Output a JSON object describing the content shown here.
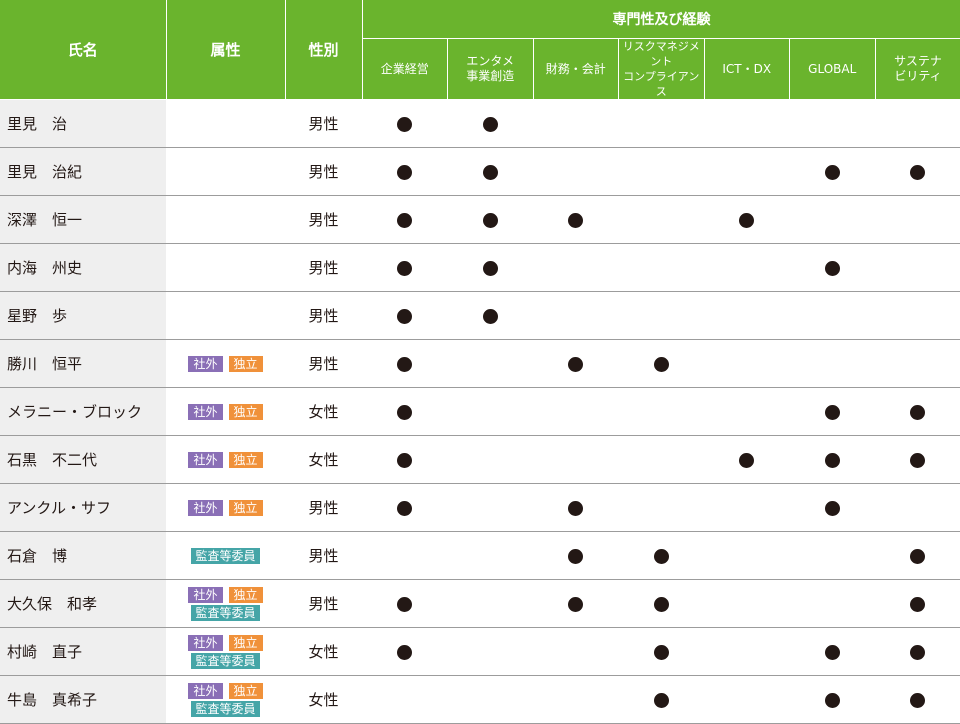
{
  "header": {
    "name": "氏名",
    "attribute": "属性",
    "gender": "性別",
    "expertise_group": "専門性及び経験",
    "skills": [
      {
        "line1": "企業経営",
        "line2": ""
      },
      {
        "line1": "エンタメ",
        "line2": "事業創造"
      },
      {
        "line1": "財務・会計",
        "line2": ""
      },
      {
        "line1": "リスクマネジメント",
        "line2": "コンプライアンス"
      },
      {
        "line1": "ICT・DX",
        "line2": ""
      },
      {
        "line1": "GLOBAL",
        "line2": ""
      },
      {
        "line1": "サステナ",
        "line2": "ビリティ"
      }
    ]
  },
  "badges": {
    "outside": "社外",
    "independent": "独立",
    "audit": "監査等委員"
  },
  "colors": {
    "header_green": "#6ab42d",
    "outside_purple": "#8a6fb6",
    "independent_orange": "#f0913a",
    "audit_teal": "#45a5a7",
    "name_cell_gray": "#efefef"
  },
  "rows": [
    {
      "name": "里見　治",
      "outside": false,
      "independent": false,
      "audit": false,
      "gender": "男性",
      "skills": [
        true,
        true,
        false,
        false,
        false,
        false,
        false
      ]
    },
    {
      "name": "里見　治紀",
      "outside": false,
      "independent": false,
      "audit": false,
      "gender": "男性",
      "skills": [
        true,
        true,
        false,
        false,
        false,
        true,
        true
      ]
    },
    {
      "name": "深澤　恒一",
      "outside": false,
      "independent": false,
      "audit": false,
      "gender": "男性",
      "skills": [
        true,
        true,
        true,
        false,
        true,
        false,
        false
      ]
    },
    {
      "name": "内海　州史",
      "outside": false,
      "independent": false,
      "audit": false,
      "gender": "男性",
      "skills": [
        true,
        true,
        false,
        false,
        false,
        true,
        false
      ]
    },
    {
      "name": "星野　歩",
      "outside": false,
      "independent": false,
      "audit": false,
      "gender": "男性",
      "skills": [
        true,
        true,
        false,
        false,
        false,
        false,
        false
      ]
    },
    {
      "name": "勝川　恒平",
      "outside": true,
      "independent": true,
      "audit": false,
      "gender": "男性",
      "skills": [
        true,
        false,
        true,
        true,
        false,
        false,
        false
      ]
    },
    {
      "name": "メラニー・ブロック",
      "outside": true,
      "independent": true,
      "audit": false,
      "gender": "女性",
      "skills": [
        true,
        false,
        false,
        false,
        false,
        true,
        true
      ]
    },
    {
      "name": "石黒　不二代",
      "outside": true,
      "independent": true,
      "audit": false,
      "gender": "女性",
      "skills": [
        true,
        false,
        false,
        false,
        true,
        true,
        true
      ]
    },
    {
      "name": "アンクル・サフ",
      "outside": true,
      "independent": true,
      "audit": false,
      "gender": "男性",
      "skills": [
        true,
        false,
        true,
        false,
        false,
        true,
        false
      ]
    },
    {
      "name": "石倉　博",
      "outside": false,
      "independent": false,
      "audit": true,
      "gender": "男性",
      "skills": [
        false,
        false,
        true,
        true,
        false,
        false,
        true
      ]
    },
    {
      "name": "大久保　和孝",
      "outside": true,
      "independent": true,
      "audit": true,
      "gender": "男性",
      "skills": [
        true,
        false,
        true,
        true,
        false,
        false,
        true
      ]
    },
    {
      "name": "村崎　直子",
      "outside": true,
      "independent": true,
      "audit": true,
      "gender": "女性",
      "skills": [
        true,
        false,
        false,
        true,
        false,
        true,
        true
      ]
    },
    {
      "name": "牛島　真希子",
      "outside": true,
      "independent": true,
      "audit": true,
      "gender": "女性",
      "skills": [
        false,
        false,
        false,
        true,
        false,
        true,
        true
      ]
    }
  ]
}
